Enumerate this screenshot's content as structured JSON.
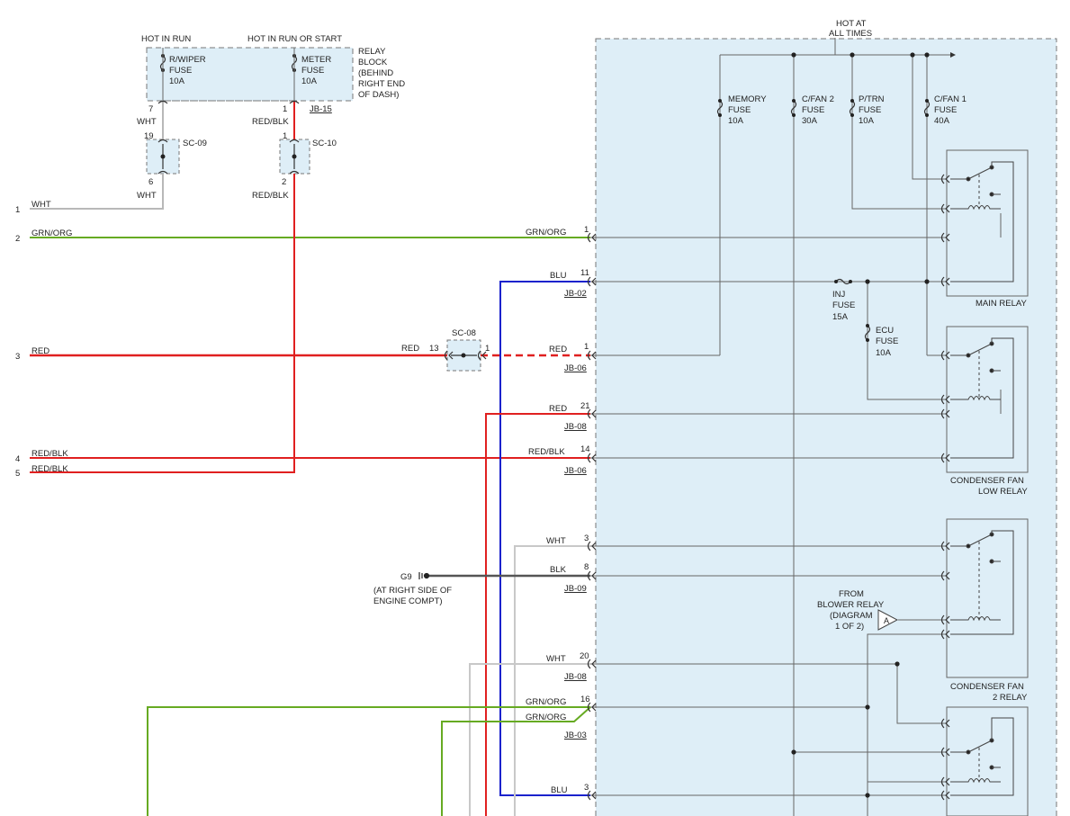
{
  "colors": {
    "red": "#e02020",
    "green": "#66aa22",
    "blue": "#1a22cc",
    "wht": "#b8b8b8",
    "blk": "#555555",
    "box_fill": "#deeef7",
    "outline": "#666666"
  },
  "hot_labels": {
    "hot_in_run": "HOT IN RUN",
    "hot_in_run_or_start": "HOT IN RUN OR START",
    "hot_at_line1": "HOT AT",
    "hot_at_line2": "ALL TIMES"
  },
  "relay_block": {
    "title_lines": [
      "RELAY",
      "BLOCK",
      "(BEHIND",
      "RIGHT END",
      "OF DASH)"
    ],
    "connector": "JB-15",
    "wiper_fuse": [
      "R/WIPER",
      "FUSE",
      "10A"
    ],
    "meter_fuse": [
      "METER",
      "FUSE",
      "10A"
    ],
    "pin_wiper": "7",
    "pin_meter": "1"
  },
  "splices": {
    "sc09": {
      "name": "SC-09",
      "pin_top": "19",
      "pin_bottom": "6",
      "wire_top": "WHT",
      "wire_bottom": "WHT"
    },
    "sc10": {
      "name": "SC-10",
      "pin_top": "1",
      "pin_bottom": "2",
      "wire_top": "RED/BLK",
      "wire_bottom": "RED/BLK"
    },
    "sc08": {
      "name": "SC-08",
      "pin_left": "13",
      "pin_right": "1"
    }
  },
  "left_wires": [
    {
      "num": "1",
      "label": "WHT"
    },
    {
      "num": "2",
      "label": "GRN/ORG"
    },
    {
      "num": "3",
      "label": "RED"
    },
    {
      "num": "4",
      "label": "RED/BLK"
    },
    {
      "num": "5",
      "label": "RED/BLK"
    }
  ],
  "connectors": [
    {
      "pin": "1",
      "wire": "GRN/ORG",
      "conn": ""
    },
    {
      "pin": "11",
      "wire": "BLU",
      "conn": "JB-02"
    },
    {
      "pin": "1",
      "wire": "RED",
      "conn": "JB-06"
    },
    {
      "pin": "21",
      "wire": "RED",
      "conn": "JB-08"
    },
    {
      "pin": "14",
      "wire": "RED/BLK",
      "conn": "JB-06"
    },
    {
      "pin": "3",
      "wire": "WHT",
      "conn": ""
    },
    {
      "pin": "8",
      "wire": "BLK",
      "conn": "JB-09"
    },
    {
      "pin": "20",
      "wire": "WHT",
      "conn": "JB-08"
    },
    {
      "pin": "16",
      "wire": "GRN/ORG",
      "conn": ""
    },
    {
      "pin": "",
      "wire": "GRN/ORG",
      "conn": "JB-03"
    },
    {
      "pin": "3",
      "wire": "BLU",
      "conn": ""
    }
  ],
  "fuses": [
    {
      "name": "MEMORY",
      "label": "FUSE",
      "amp": "10A"
    },
    {
      "name": "C/FAN 2",
      "label": "FUSE",
      "amp": "30A"
    },
    {
      "name": "P/TRN",
      "label": "FUSE",
      "amp": "10A"
    },
    {
      "name": "C/FAN 1",
      "label": "FUSE",
      "amp": "40A"
    },
    {
      "name": "INJ",
      "label": "FUSE",
      "amp": "15A"
    },
    {
      "name": "ECU",
      "label": "FUSE",
      "amp": "10A"
    }
  ],
  "relays": [
    {
      "lines": [
        "MAIN RELAY"
      ]
    },
    {
      "lines": [
        "CONDENSER FAN",
        "LOW RELAY"
      ]
    },
    {
      "lines": [
        "CONDENSER FAN",
        "2 RELAY"
      ]
    }
  ],
  "ground": {
    "name": "G9",
    "location": [
      "(AT RIGHT SIDE OF",
      "ENGINE COMPT)"
    ]
  },
  "blower_ref": {
    "lines": [
      "FROM",
      "BLOWER RELAY",
      "(DIAGRAM",
      "1 OF 2)"
    ],
    "marker": "A"
  }
}
